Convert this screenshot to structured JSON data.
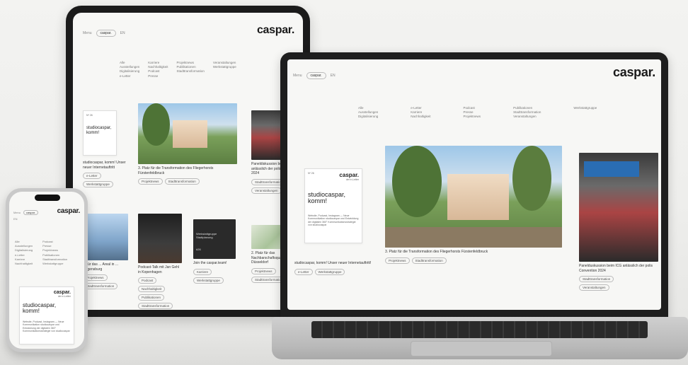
{
  "brand": "caspar.",
  "nav": {
    "menu": "Menu",
    "search": "caspar.",
    "lang": "EN"
  },
  "menu_columns": [
    [
      "Alle",
      "Ausstellungen",
      "Digitalisierung"
    ],
    [
      "e-Letter",
      "Karriere",
      "Nachhaltigkeit"
    ],
    [
      "Podcast",
      "Presse",
      "Projektnews"
    ],
    [
      "Publikationen",
      "Stadttransformation",
      "Veranstaltungen"
    ],
    [
      "Werkstattgruppe"
    ]
  ],
  "poster": {
    "no": "Nº 26",
    "brand": "caspar.",
    "sub": "der e-Letter",
    "headline": "studiocaspar, komm!",
    "blurb": "Website, Podcast, Instagram — Neue Kommunikation studiocaspar und Entwicklung der digitalen 360° Kommunikationsstrategie von studiocaspar"
  },
  "laptop_cards": [
    {
      "caption": "studiocaspar, komm! Unser neuer Internetauftritt!",
      "tags": [
        "e-Letter",
        "Werkstattgruppe"
      ]
    },
    {
      "caption": "3. Platz für die Transformation des Fliegerhorsts Fürstenfeldbruck",
      "tags": [
        "Projektnews",
        "Stadttransformation"
      ]
    },
    {
      "caption": "Panelduskussion beim ICG anlässlich der polis Convention 2024",
      "tags": [
        "Stadttransformation",
        "Veranstaltungen"
      ]
    }
  ],
  "tablet_cards": [
    {
      "caption": "studiocaspar, komm! Unser neuer Internetauftritt",
      "tags": [
        "e-Letter",
        "Werkstattgruppe"
      ]
    },
    {
      "caption": "3. Platz für die Transformation des Fliegerhorsts Fürstenfeldbruck",
      "tags": [
        "Projektnews",
        "Stadttransformation"
      ]
    },
    {
      "caption": "Paneldiskussion beim ICG anlässlich der polis Convention 2024",
      "tags": [
        "Stadttransformation",
        "Veranstaltungen"
      ]
    },
    {
      "caption": "... für das ... Areal in ... Regensburg",
      "tags": [
        "Projektnews",
        "Stadttransformation"
      ]
    },
    {
      "caption": "Podcast-Talk mit Jan Gehl in Kopenhagen",
      "tags": [
        "Podcast",
        "Nachhaltigkeit",
        "Publikationen",
        "Stadttransformation"
      ]
    },
    {
      "caption": "Join the caspar.team!",
      "tags": [
        "Karriere",
        "Werkstattgruppe"
      ]
    },
    {
      "caption": "2. Platz für das Nachbarschaftsquartier in Düsseldorf",
      "tags": [
        "Projektnews",
        "Stadttransformation"
      ]
    }
  ],
  "dark_card": {
    "line1": "Werkstattgruppe",
    "line2": "Stadtplanung",
    "footer": "#26"
  }
}
